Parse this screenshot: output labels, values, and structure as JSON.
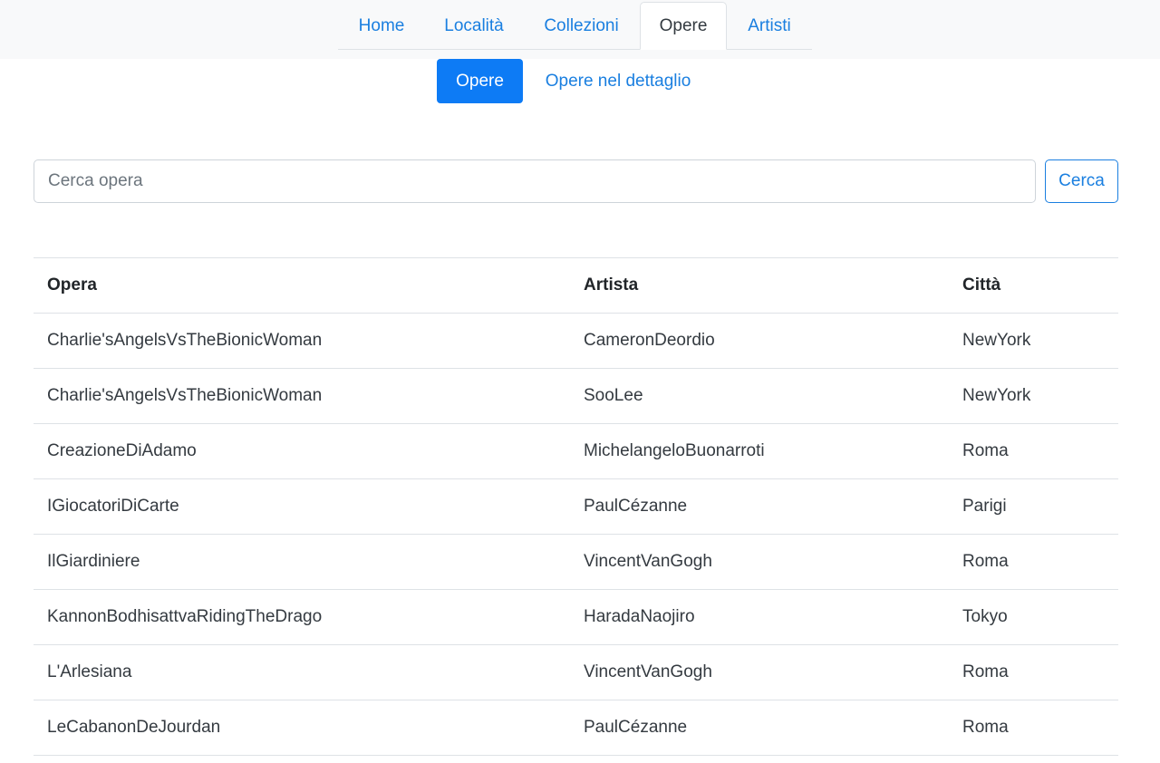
{
  "nav": {
    "tabs": [
      {
        "label": "Home",
        "active": false
      },
      {
        "label": "Località",
        "active": false
      },
      {
        "label": "Collezioni",
        "active": false
      },
      {
        "label": "Opere",
        "active": true
      },
      {
        "label": "Artisti",
        "active": false
      }
    ]
  },
  "subnav": {
    "tabs": [
      {
        "label": "Opere",
        "active": true
      },
      {
        "label": "Opere nel dettaglio",
        "active": false
      }
    ]
  },
  "search": {
    "placeholder": "Cerca opera",
    "value": "",
    "button_label": "Cerca"
  },
  "table": {
    "headers": [
      "Opera",
      "Artista",
      "Città"
    ],
    "rows": [
      [
        "Charlie'sAngelsVsTheBionicWoman",
        "CameronDeordio",
        "NewYork"
      ],
      [
        "Charlie'sAngelsVsTheBionicWoman",
        "SooLee",
        "NewYork"
      ],
      [
        "CreazioneDiAdamo",
        "MichelangeloBuonarroti",
        "Roma"
      ],
      [
        "IGiocatoriDiCarte",
        "PaulCézanne",
        "Parigi"
      ],
      [
        "IlGiardiniere",
        "VincentVanGogh",
        "Roma"
      ],
      [
        "KannonBodhisattvaRidingTheDrago",
        "HaradaNaojiro",
        "Tokyo"
      ],
      [
        "L'Arlesiana",
        "VincentVanGogh",
        "Roma"
      ],
      [
        "LeCabanonDeJourdan",
        "PaulCézanne",
        "Roma"
      ]
    ]
  },
  "colors": {
    "accent": "#0d7bf5",
    "link": "#1a7fe0",
    "topbar_bg": "#f8f9fa",
    "border": "#dee2e6"
  }
}
